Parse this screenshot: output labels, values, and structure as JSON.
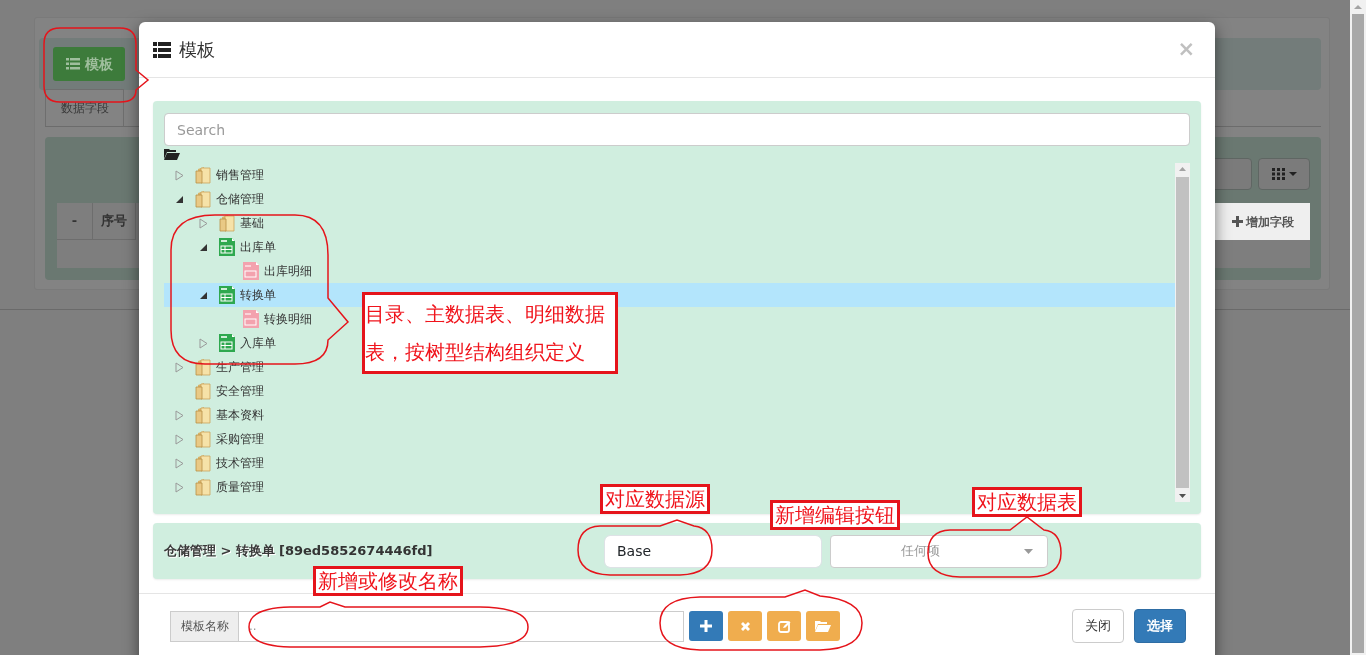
{
  "background": {
    "template_button": "模板",
    "tab": "数据字段",
    "columns": [
      "-",
      "序号"
    ],
    "add_field_button": "增加字段"
  },
  "modal": {
    "title": "模板",
    "close": "×",
    "search": {
      "placeholder": "Search"
    },
    "tree": [
      {
        "label": "销售管理",
        "kind": "folder",
        "expanded": false,
        "selected": false
      },
      {
        "label": "仓储管理",
        "kind": "folder",
        "expanded": true,
        "selected": false,
        "children": [
          {
            "label": "基础",
            "kind": "folder",
            "expanded": false,
            "selected": false
          },
          {
            "label": "出库单",
            "kind": "table",
            "expanded": true,
            "selected": false,
            "children": [
              {
                "label": "出库明细",
                "kind": "detail",
                "selected": false
              }
            ]
          },
          {
            "label": "转换单",
            "kind": "table",
            "expanded": true,
            "selected": true,
            "children": [
              {
                "label": "转换明细",
                "kind": "detail",
                "selected": false
              }
            ]
          },
          {
            "label": "入库单",
            "kind": "table",
            "expanded": false,
            "selected": false
          }
        ]
      },
      {
        "label": "生产管理",
        "kind": "folder",
        "expanded": false,
        "selected": false
      },
      {
        "label": "安全管理",
        "kind": "folder",
        "selected": false
      },
      {
        "label": "基本资料",
        "kind": "folder",
        "expanded": false,
        "selected": false
      },
      {
        "label": "采购管理",
        "kind": "folder",
        "expanded": false,
        "selected": false
      },
      {
        "label": "技术管理",
        "kind": "folder",
        "expanded": false,
        "selected": false
      },
      {
        "label": "质量管理",
        "kind": "folder",
        "expanded": false,
        "selected": false
      }
    ],
    "breadcrumb": {
      "path": "仓储管理 > 转换单",
      "id": "[89ed5852674446fd]"
    },
    "datasource": {
      "value": "Base"
    },
    "table_select": {
      "placeholder": "任何项"
    },
    "name_label": "模板名称",
    "name_input": {
      "placeholder": ".."
    },
    "tool_buttons": [
      {
        "kind": "add"
      },
      {
        "kind": "delete"
      },
      {
        "kind": "edit"
      },
      {
        "kind": "open"
      }
    ],
    "footer_buttons": [
      "关闭",
      "选择"
    ]
  },
  "annotations": [
    "目录、主数据表、明细数据表，按树型结构组织定义",
    "对应数据源",
    "对应数据表",
    "新增编辑按钮",
    "新增或修改名称"
  ]
}
